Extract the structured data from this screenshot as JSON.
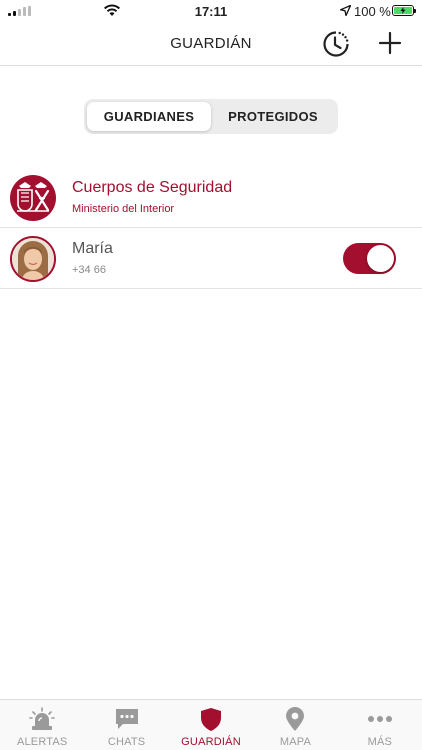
{
  "status_bar": {
    "time": "17:11",
    "battery": "100 %"
  },
  "nav": {
    "title": "GUARDIÁN",
    "history_icon": "clock-history-icon",
    "add_icon": "plus-icon"
  },
  "segmented": {
    "options": [
      "GUARDIANES",
      "PROTEGIDOS"
    ],
    "selected": "GUARDIANES"
  },
  "guardians": [
    {
      "name": "Cuerpos de Seguridad",
      "subtitle": "Ministerio del Interior",
      "avatar": "police-emblem"
    },
    {
      "name": "María",
      "subtitle": "+34 66",
      "avatar": "profile-photo",
      "enabled": true
    }
  ],
  "tabbar": {
    "items": [
      {
        "label": "ALERTAS",
        "icon": "siren-icon"
      },
      {
        "label": "CHATS",
        "icon": "chat-icon"
      },
      {
        "label": "GUARDIÁN",
        "icon": "shield-icon"
      },
      {
        "label": "MAPA",
        "icon": "map-pin-icon"
      },
      {
        "label": "MÁS",
        "icon": "more-icon"
      }
    ],
    "active": "GUARDIÁN"
  },
  "colors": {
    "accent": "#a30f2e",
    "inactive": "#9a9a9a"
  }
}
